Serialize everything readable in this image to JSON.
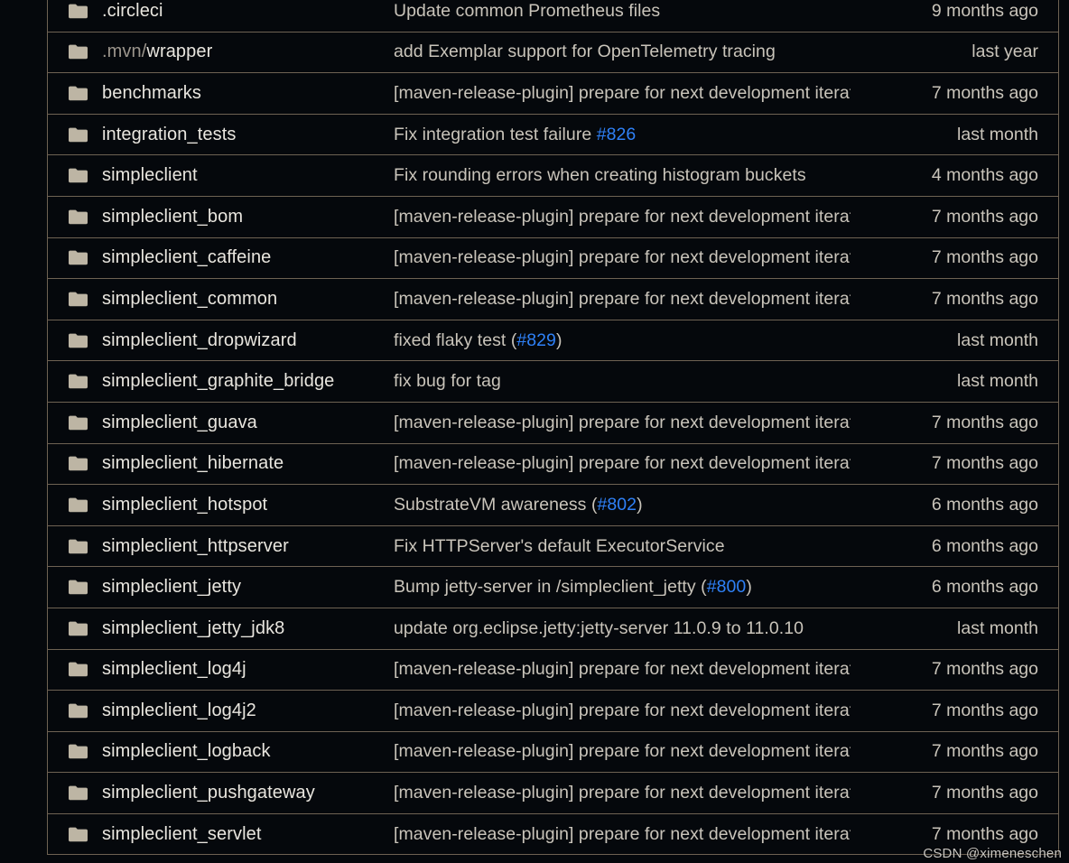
{
  "colors": {
    "background": "#05080c",
    "row_divider": "#6e6253",
    "folder_icon": "#bdb5a4",
    "name_text": "#e9e6df",
    "message_text": "#c9c4ba",
    "link_blue": "#2f81f7"
  },
  "table": {
    "columns": [
      "name",
      "last_commit_message",
      "last_commit_time"
    ],
    "rows": [
      {
        "icon": "folder-icon",
        "name": ".circleci",
        "name_prefix": "",
        "message": "Update common Prometheus files",
        "message_parts": [
          {
            "text": "Update common Prometheus files",
            "link": false
          }
        ],
        "time": "9 months ago"
      },
      {
        "icon": "folder-icon",
        "name": "wrapper",
        "name_prefix": ".mvn/",
        "message": "add Exemplar support for OpenTelemetry tracing",
        "message_parts": [
          {
            "text": "add Exemplar support for OpenTelemetry tracing",
            "link": false
          }
        ],
        "time": "last year"
      },
      {
        "icon": "folder-icon",
        "name": "benchmarks",
        "name_prefix": "",
        "message": "[maven-release-plugin] prepare for next development iteration",
        "message_parts": [
          {
            "text": "[maven-release-plugin] prepare for next development iteration",
            "link": false
          }
        ],
        "time": "7 months ago"
      },
      {
        "icon": "folder-icon",
        "name": "integration_tests",
        "name_prefix": "",
        "message": "Fix integration test failure #826",
        "message_parts": [
          {
            "text": "Fix integration test failure ",
            "link": false
          },
          {
            "text": "#826",
            "link": true
          }
        ],
        "time": "last month"
      },
      {
        "icon": "folder-icon",
        "name": "simpleclient",
        "name_prefix": "",
        "message": "Fix rounding errors when creating histogram buckets",
        "message_parts": [
          {
            "text": "Fix rounding errors when creating histogram buckets",
            "link": false
          }
        ],
        "time": "4 months ago"
      },
      {
        "icon": "folder-icon",
        "name": "simpleclient_bom",
        "name_prefix": "",
        "message": "[maven-release-plugin] prepare for next development iteration",
        "message_parts": [
          {
            "text": "[maven-release-plugin] prepare for next development iteration",
            "link": false
          }
        ],
        "time": "7 months ago"
      },
      {
        "icon": "folder-icon",
        "name": "simpleclient_caffeine",
        "name_prefix": "",
        "message": "[maven-release-plugin] prepare for next development iteration",
        "message_parts": [
          {
            "text": "[maven-release-plugin] prepare for next development iteration",
            "link": false
          }
        ],
        "time": "7 months ago"
      },
      {
        "icon": "folder-icon",
        "name": "simpleclient_common",
        "name_prefix": "",
        "message": "[maven-release-plugin] prepare for next development iteration",
        "message_parts": [
          {
            "text": "[maven-release-plugin] prepare for next development iteration",
            "link": false
          }
        ],
        "time": "7 months ago"
      },
      {
        "icon": "folder-icon",
        "name": "simpleclient_dropwizard",
        "name_prefix": "",
        "message": "fixed flaky test (#829)",
        "message_parts": [
          {
            "text": "fixed flaky test (",
            "link": false
          },
          {
            "text": "#829",
            "link": true
          },
          {
            "text": ")",
            "link": false
          }
        ],
        "time": "last month"
      },
      {
        "icon": "folder-icon",
        "name": "simpleclient_graphite_bridge",
        "name_prefix": "",
        "message": "fix bug for tag",
        "message_parts": [
          {
            "text": "fix bug for tag",
            "link": false
          }
        ],
        "time": "last month"
      },
      {
        "icon": "folder-icon",
        "name": "simpleclient_guava",
        "name_prefix": "",
        "message": "[maven-release-plugin] prepare for next development iteration",
        "message_parts": [
          {
            "text": "[maven-release-plugin] prepare for next development iteration",
            "link": false
          }
        ],
        "time": "7 months ago"
      },
      {
        "icon": "folder-icon",
        "name": "simpleclient_hibernate",
        "name_prefix": "",
        "message": "[maven-release-plugin] prepare for next development iteration",
        "message_parts": [
          {
            "text": "[maven-release-plugin] prepare for next development iteration",
            "link": false
          }
        ],
        "time": "7 months ago"
      },
      {
        "icon": "folder-icon",
        "name": "simpleclient_hotspot",
        "name_prefix": "",
        "message": "SubstrateVM awareness (#802)",
        "message_parts": [
          {
            "text": "SubstrateVM awareness (",
            "link": false
          },
          {
            "text": "#802",
            "link": true
          },
          {
            "text": ")",
            "link": false
          }
        ],
        "time": "6 months ago"
      },
      {
        "icon": "folder-icon",
        "name": "simpleclient_httpserver",
        "name_prefix": "",
        "message": "Fix HTTPServer's default ExecutorService",
        "message_parts": [
          {
            "text": "Fix HTTPServer's default ExecutorService",
            "link": false
          }
        ],
        "time": "6 months ago"
      },
      {
        "icon": "folder-icon",
        "name": "simpleclient_jetty",
        "name_prefix": "",
        "message": "Bump jetty-server in /simpleclient_jetty (#800)",
        "message_parts": [
          {
            "text": "Bump jetty-server in /simpleclient_jetty (",
            "link": false
          },
          {
            "text": "#800",
            "link": true
          },
          {
            "text": ")",
            "link": false
          }
        ],
        "time": "6 months ago"
      },
      {
        "icon": "folder-icon",
        "name": "simpleclient_jetty_jdk8",
        "name_prefix": "",
        "message": "update org.eclipse.jetty:jetty-server 11.0.9 to 11.0.10",
        "message_parts": [
          {
            "text": "update org.eclipse.jetty:jetty-server 11.0.9 to 11.0.10",
            "link": false
          }
        ],
        "time": "last month"
      },
      {
        "icon": "folder-icon",
        "name": "simpleclient_log4j",
        "name_prefix": "",
        "message": "[maven-release-plugin] prepare for next development iteration",
        "message_parts": [
          {
            "text": "[maven-release-plugin] prepare for next development iteration",
            "link": false
          }
        ],
        "time": "7 months ago"
      },
      {
        "icon": "folder-icon",
        "name": "simpleclient_log4j2",
        "name_prefix": "",
        "message": "[maven-release-plugin] prepare for next development iteration",
        "message_parts": [
          {
            "text": "[maven-release-plugin] prepare for next development iteration",
            "link": false
          }
        ],
        "time": "7 months ago"
      },
      {
        "icon": "folder-icon",
        "name": "simpleclient_logback",
        "name_prefix": "",
        "message": "[maven-release-plugin] prepare for next development iteration",
        "message_parts": [
          {
            "text": "[maven-release-plugin] prepare for next development iteration",
            "link": false
          }
        ],
        "time": "7 months ago"
      },
      {
        "icon": "folder-icon",
        "name": "simpleclient_pushgateway",
        "name_prefix": "",
        "message": "[maven-release-plugin] prepare for next development iteration",
        "message_parts": [
          {
            "text": "[maven-release-plugin] prepare for next development iteration",
            "link": false
          }
        ],
        "time": "7 months ago"
      },
      {
        "icon": "folder-icon",
        "name": "simpleclient_servlet",
        "name_prefix": "",
        "message": "[maven-release-plugin] prepare for next development iteration",
        "message_parts": [
          {
            "text": "[maven-release-plugin] prepare for next development iteration",
            "link": false
          }
        ],
        "time": "7 months ago"
      }
    ]
  },
  "watermark": {
    "text": "CSDN @ximeneschen"
  }
}
